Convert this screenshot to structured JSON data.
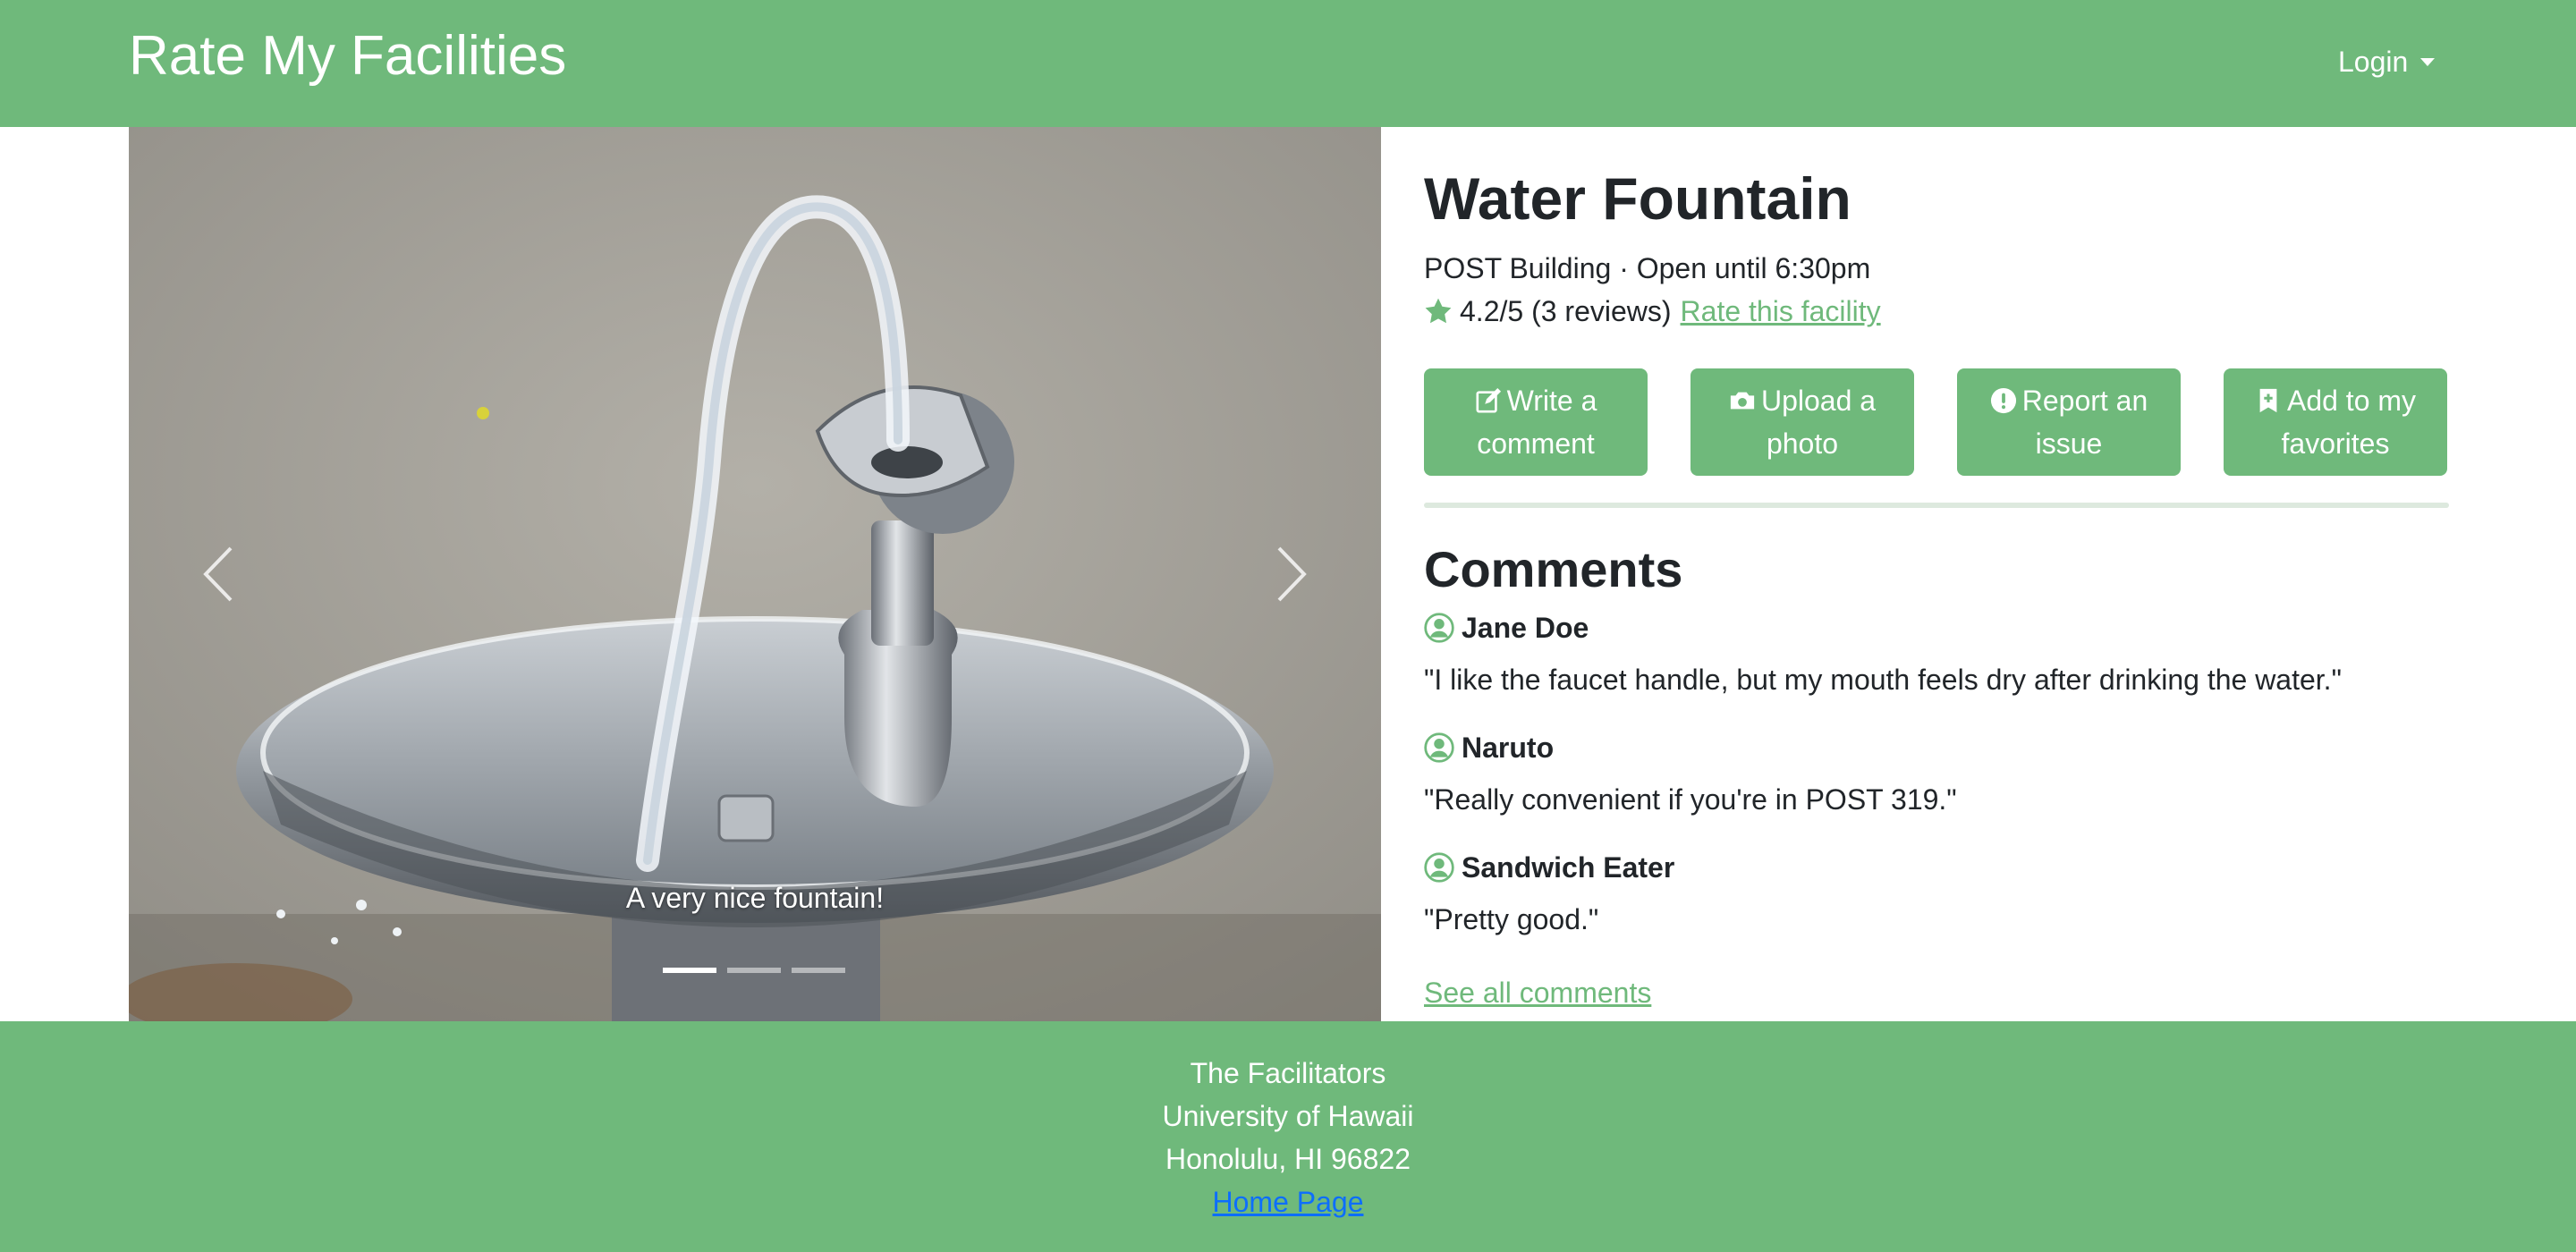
{
  "navbar": {
    "brand": "Rate My Facilities",
    "login_label": "Login"
  },
  "carousel": {
    "caption": "A very nice fountain!",
    "slide_count": 3,
    "active_slide": 1,
    "prev_icon": "chevron-left-icon",
    "next_icon": "chevron-right-icon"
  },
  "facility": {
    "name": "Water Fountain",
    "location_hours": "POST Building · Open until 6:30pm",
    "rating_text": "4.2/5 (3 reviews)",
    "rate_link": "Rate this facility",
    "star_icon": "star-icon"
  },
  "actions": [
    {
      "label": "Write a comment",
      "icon": "pencil-square-icon"
    },
    {
      "label": "Upload a photo",
      "icon": "camera-icon"
    },
    {
      "label": "Report an issue",
      "icon": "exclamation-circle-icon"
    },
    {
      "label": "Add to my favorites",
      "icon": "bookmark-plus-icon"
    }
  ],
  "comments": {
    "heading": "Comments",
    "items": [
      {
        "user": "Jane Doe",
        "text": "\"I like the faucet handle, but my mouth feels dry after drinking the water.\""
      },
      {
        "user": "Naruto",
        "text": "\"Really convenient if you're in POST 319.\""
      },
      {
        "user": "Sandwich Eater",
        "text": "\"Pretty good.\""
      }
    ],
    "see_all": "See all comments"
  },
  "footer": {
    "line1": "The Facilitators",
    "line2": "University of Hawaii",
    "line3": "Honolulu, HI 96822",
    "home_link": "Home Page"
  },
  "colors": {
    "brand_green": "#6fb97b",
    "link_blue": "#0d6efd",
    "text_dark": "#212529"
  }
}
